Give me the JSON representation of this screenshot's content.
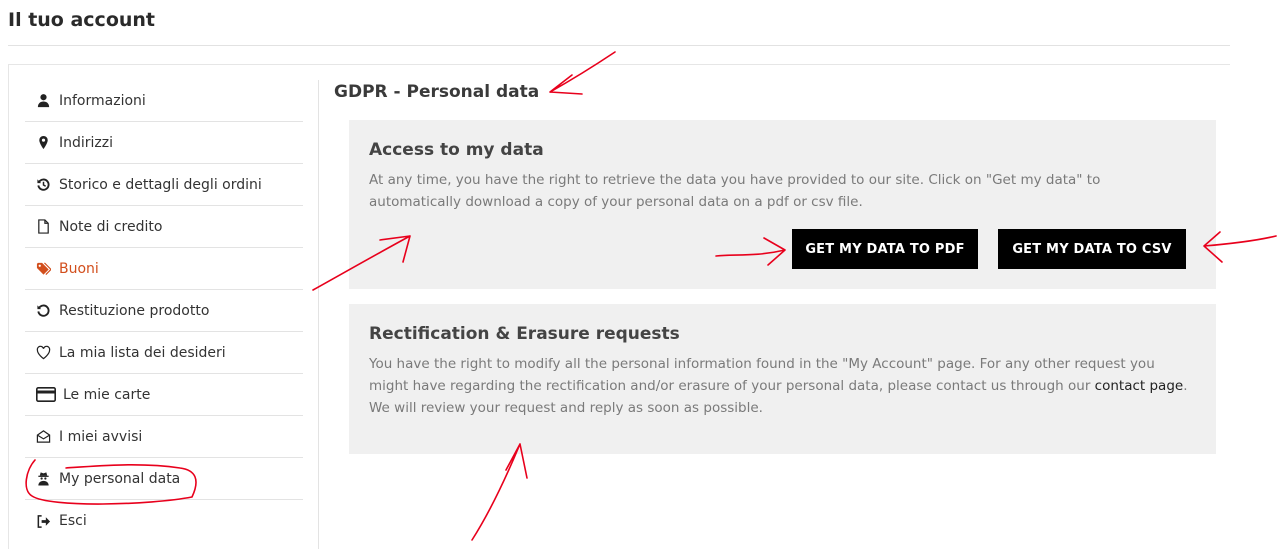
{
  "page": {
    "title": "Il tuo account"
  },
  "sidebar": {
    "items": [
      {
        "label": "Informazioni",
        "icon": "user-icon",
        "active": false
      },
      {
        "label": "Indirizzi",
        "icon": "map-marker-icon",
        "active": false
      },
      {
        "label": "Storico e dettagli degli ordini",
        "icon": "history-icon",
        "active": false
      },
      {
        "label": "Note di credito",
        "icon": "file-icon",
        "active": false
      },
      {
        "label": "Buoni",
        "icon": "tags-icon",
        "active": true
      },
      {
        "label": "Restituzione prodotto",
        "icon": "undo-icon",
        "active": false
      },
      {
        "label": "La mia lista dei desideri",
        "icon": "heart-icon",
        "active": false
      },
      {
        "label": "Le mie carte",
        "icon": "credit-card-icon",
        "active": false
      },
      {
        "label": "I miei avvisi",
        "icon": "envelope-open-icon",
        "active": false
      },
      {
        "label": "My personal data",
        "icon": "user-secret-icon",
        "active": false
      },
      {
        "label": "Esci",
        "icon": "sign-out-icon",
        "active": false
      }
    ]
  },
  "gdpr": {
    "title": "GDPR - Personal data",
    "access": {
      "heading": "Access to my data",
      "text": "At any time, you have the right to retrieve the data you have provided to our site. Click on \"Get my data\" to automatically download a copy of your personal data on a pdf or csv file.",
      "pdf_button": "GET MY DATA TO PDF",
      "csv_button": "GET MY DATA TO CSV"
    },
    "rectification": {
      "heading": "Rectification & Erasure requests",
      "text_before": "You have the right to modify all the personal information found in the \"My Account\" page. For any other request you might have regarding the rectification and/or erasure of your personal data, please contact us through our ",
      "link": "contact page",
      "text_after": ". We will review your request and reply as soon as possible."
    }
  },
  "colors": {
    "accent": "#d24e1c",
    "button_bg": "#000000",
    "box_bg": "#f0f0f0",
    "annotation": "#e8001c"
  }
}
